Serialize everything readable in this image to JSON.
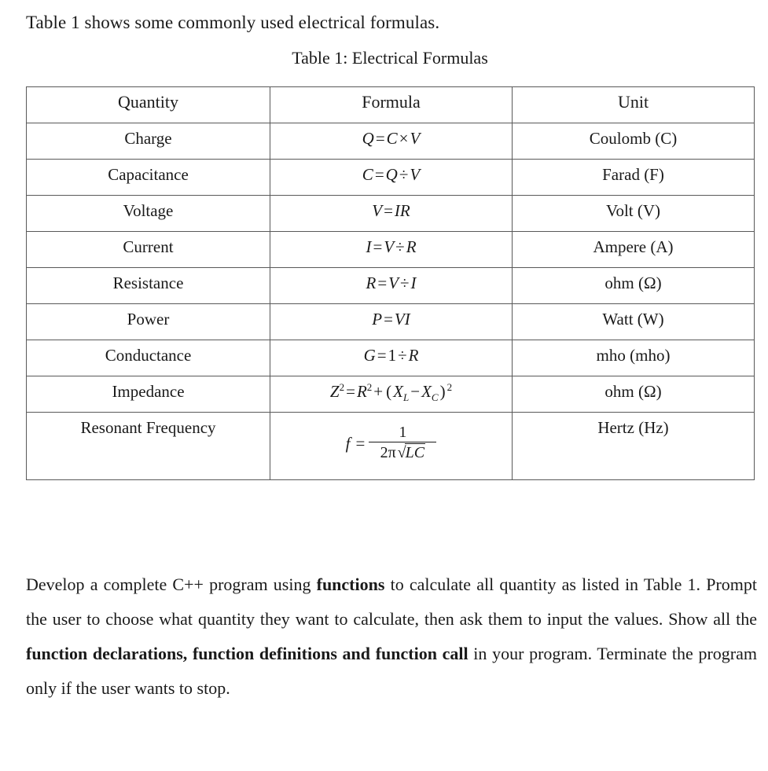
{
  "document": {
    "intro_line": "Table 1 shows some commonly used electrical formulas.",
    "table_caption": "Table 1: Electrical Formulas"
  },
  "table": {
    "columns": [
      "Quantity",
      "Formula",
      "Unit"
    ],
    "rows": [
      {
        "quantity": "Charge",
        "formula": "Q = C × V",
        "unit": "Coulomb (C)"
      },
      {
        "quantity": "Capacitance",
        "formula": "C = Q ÷ V",
        "unit": "Farad (F)"
      },
      {
        "quantity": "Voltage",
        "formula": "V = IR",
        "unit": "Volt (V)"
      },
      {
        "quantity": "Current",
        "formula": "I = V ÷ R",
        "unit": "Ampere (A)"
      },
      {
        "quantity": "Resistance",
        "formula": "R = V ÷ I",
        "unit": "ohm (Ω)"
      },
      {
        "quantity": "Power",
        "formula": "P = VI",
        "unit": "Watt (W)"
      },
      {
        "quantity": "Conductance",
        "formula": "G = 1 ÷ R",
        "unit": "mho (mho)"
      },
      {
        "quantity": "Impedance",
        "formula": "Z² = R² + (X_L − X_C)²",
        "unit": "ohm (Ω)"
      },
      {
        "quantity": "Resonant Frequency",
        "formula": "f = 1 / (2π√(LC))",
        "unit": "Hertz (Hz)"
      }
    ]
  },
  "formula_parts": {
    "charge": {
      "lhs": "Q",
      "eq": "=",
      "a": "C",
      "op": "×",
      "b": "V"
    },
    "capacitance": {
      "lhs": "C",
      "eq": "=",
      "a": "Q",
      "op": "÷",
      "b": "V"
    },
    "voltage": {
      "lhs": "V",
      "eq": "=",
      "a": "IR"
    },
    "current": {
      "lhs": "I",
      "eq": "=",
      "a": "V",
      "op": "÷",
      "b": "R"
    },
    "resistance": {
      "lhs": "R",
      "eq": "=",
      "a": "V",
      "op": "÷",
      "b": "I"
    },
    "power": {
      "lhs": "P",
      "eq": "=",
      "a": "VI"
    },
    "conductance": {
      "lhs": "G",
      "eq": "=",
      "a": "1",
      "op": "÷",
      "b": "R"
    },
    "impedance": {
      "z": "Z",
      "z_exp": "2",
      "eq": "=",
      "r": "R",
      "r_exp": "2",
      "plus": "+",
      "open": "(",
      "x1": "X",
      "x1_sub": "L",
      "minus": "−",
      "x2": "X",
      "x2_sub": "C",
      "close": ")",
      "close_exp": "2"
    },
    "resonant": {
      "f": "f",
      "eq": "=",
      "numerator": "1",
      "den_coeff": "2π",
      "radicand": "LC",
      "radical": "√"
    }
  },
  "paragraph": {
    "segments": [
      {
        "text": "Develop a complete C++ program using ",
        "bold": false
      },
      {
        "text": "functions",
        "bold": true
      },
      {
        "text": " to calculate all quantity as listed in Table 1. Prompt the user to choose what quantity they want to calculate, then ask them to input the values. Show all the ",
        "bold": false
      },
      {
        "text": "function declarations, function definitions and function call",
        "bold": true
      },
      {
        "text": " in your program. Terminate the program only if the user wants to stop.",
        "bold": false
      }
    ],
    "full_text": "Develop a complete C++ program using functions to calculate all quantity as listed in Table 1. Prompt the user to choose what quantity they want to calculate, then ask them to input the values. Show all the function declarations, function definitions and function call in your program. Terminate the program only if the user wants to stop."
  },
  "colors": {
    "page_background": "#ffffff",
    "text": "#1a1a1a",
    "table_border": "#595959"
  }
}
